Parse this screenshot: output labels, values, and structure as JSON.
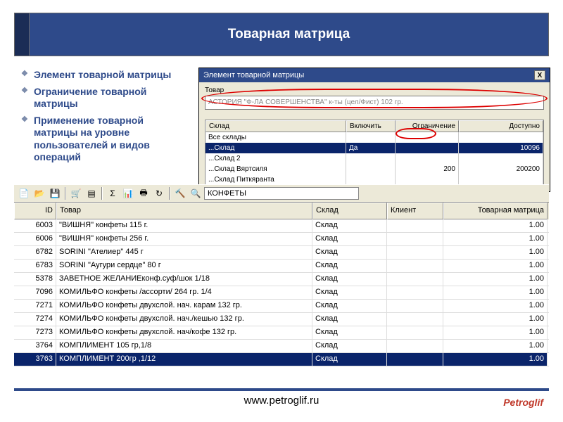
{
  "title": "Товарная матрица",
  "bullets": [
    "Элемент товарной матрицы",
    "Ограничение товарной матрицы",
    "Применение товарной матрицы на уровне пользователей и видов операций"
  ],
  "dialog": {
    "title": "Элемент товарной матрицы",
    "close": "X",
    "field_label": "Товар",
    "field_value": "АСТОРИЯ \"Ф-ЛА СОВЕРШЕНСТВА\" к-ты (цел/Фист) 102 гр.",
    "cols": {
      "sklad": "Склад",
      "vkl": "Включить",
      "ogr": "Ограничение",
      "dost": "Доступно"
    },
    "rows": [
      {
        "sklad": "Все склады",
        "vkl": "",
        "ogr": "",
        "dost": ""
      },
      {
        "sklad": "...Склад",
        "vkl": "Да",
        "ogr": "",
        "dost": "10096",
        "selected": true
      },
      {
        "sklad": "...Склад 2",
        "vkl": "",
        "ogr": "",
        "dost": ""
      },
      {
        "sklad": "...Склад Вяртсиля",
        "vkl": "",
        "ogr": "200",
        "dost": "200200"
      },
      {
        "sklad": "...Склад Питкяранта",
        "vkl": "",
        "ogr": "",
        "dost": ""
      }
    ]
  },
  "toolbar_filter": "КОНФЕТЫ",
  "main_cols": {
    "id": "ID",
    "tovar": "Товар",
    "sklad": "Склад",
    "klient": "Клиент",
    "matrix": "Товарная матрица"
  },
  "main_rows": [
    {
      "id": "6003",
      "tovar": "\"ВИШНЯ\" конфеты 115 г.",
      "sklad": "Склад",
      "klient": "",
      "matrix": "1.00"
    },
    {
      "id": "6006",
      "tovar": "\"ВИШНЯ\" конфеты 256 г.",
      "sklad": "Склад",
      "klient": "",
      "matrix": "1.00"
    },
    {
      "id": "6782",
      "tovar": "SORINI \"Ателиер\" 445 г",
      "sklad": "Склад",
      "klient": "",
      "matrix": "1.00"
    },
    {
      "id": "6783",
      "tovar": "SORINI \"Аугури сердце\" 80 г",
      "sklad": "Склад",
      "klient": "",
      "matrix": "1.00"
    },
    {
      "id": "5378",
      "tovar": "ЗАВЕТНОЕ ЖЕЛАНИЕконф.суф/шок 1/18",
      "sklad": "Склад",
      "klient": "",
      "matrix": "1.00"
    },
    {
      "id": "7096",
      "tovar": "КОМИЛЬФО конфеты  /ассорти/ 264 гр. 1/4",
      "sklad": "Склад",
      "klient": "",
      "matrix": "1.00"
    },
    {
      "id": "7271",
      "tovar": "КОМИЛЬФО конфеты двухслой. нач. карам 132 гр.",
      "sklad": "Склад",
      "klient": "",
      "matrix": "1.00"
    },
    {
      "id": "7274",
      "tovar": "КОМИЛЬФО конфеты двухслой. нач./кешью 132 гр.",
      "sklad": "Склад",
      "klient": "",
      "matrix": "1.00"
    },
    {
      "id": "7273",
      "tovar": "КОМИЛЬФО конфеты двухслой. нач/кофе 132 гр.",
      "sklad": "Склад",
      "klient": "",
      "matrix": "1.00"
    },
    {
      "id": "3764",
      "tovar": "КОМПЛИМЕНТ 105 гр,1/8",
      "sklad": "Склад",
      "klient": "",
      "matrix": "1.00"
    },
    {
      "id": "3763",
      "tovar": "КОМПЛИМЕНТ 200гр ,1/12",
      "sklad": "Склад",
      "klient": "",
      "matrix": "1.00",
      "selected": true
    }
  ],
  "footer": {
    "url": "www.petroglif.ru",
    "logo": "Petroglif"
  }
}
